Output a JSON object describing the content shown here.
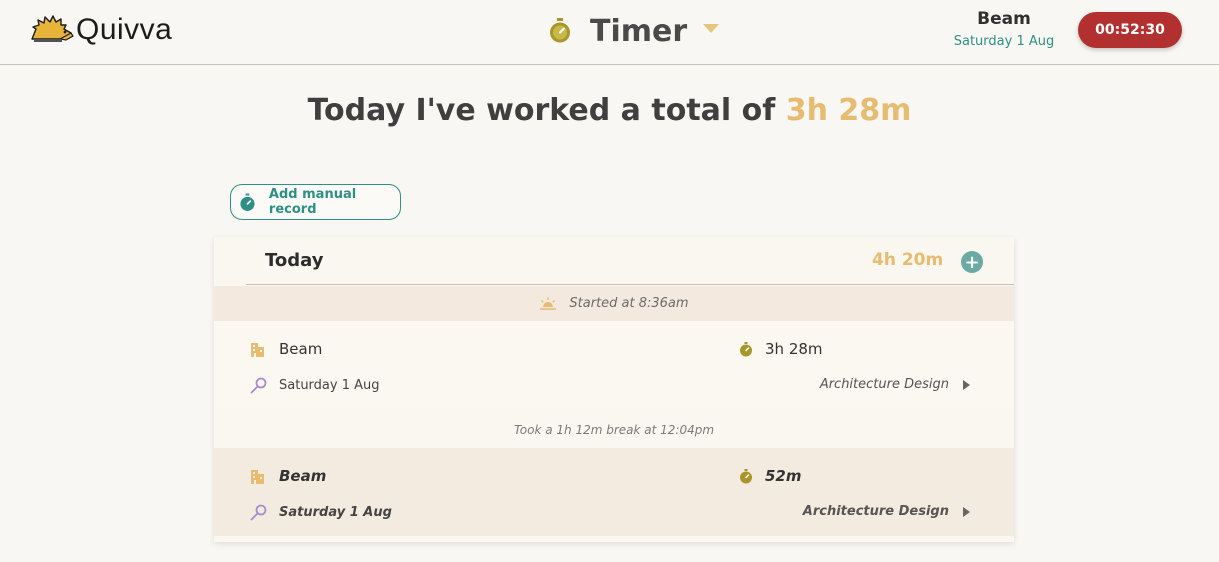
{
  "app": {
    "name": "Quivva"
  },
  "header": {
    "page_title": "Timer",
    "user_name": "Beam",
    "user_date": "Saturday 1 Aug",
    "running_timer": "00:52:30"
  },
  "summary": {
    "prefix": "Today I've worked a total of",
    "total": "3h 28m"
  },
  "actions": {
    "add_manual_label": "Add manual record",
    "add_record_symbol": "+"
  },
  "day": {
    "title": "Today",
    "total": "4h 20m",
    "started_text": "Started at 8:36am",
    "break_text": "Took a 1h 12m break at 12:04pm",
    "records": [
      {
        "client": "Beam",
        "date": "Saturday 1 Aug",
        "duration": "3h 28m",
        "task": "Architecture Design"
      },
      {
        "client": "Beam",
        "date": "Saturday 1 Aug",
        "duration": "52m",
        "task": "Architecture Design"
      }
    ]
  },
  "colors": {
    "accent_teal": "#2e8f85",
    "accent_gold": "#e7bb70",
    "timer_red": "#b33030",
    "icon_olive": "#a8962a",
    "icon_purple": "#a98bd0"
  }
}
